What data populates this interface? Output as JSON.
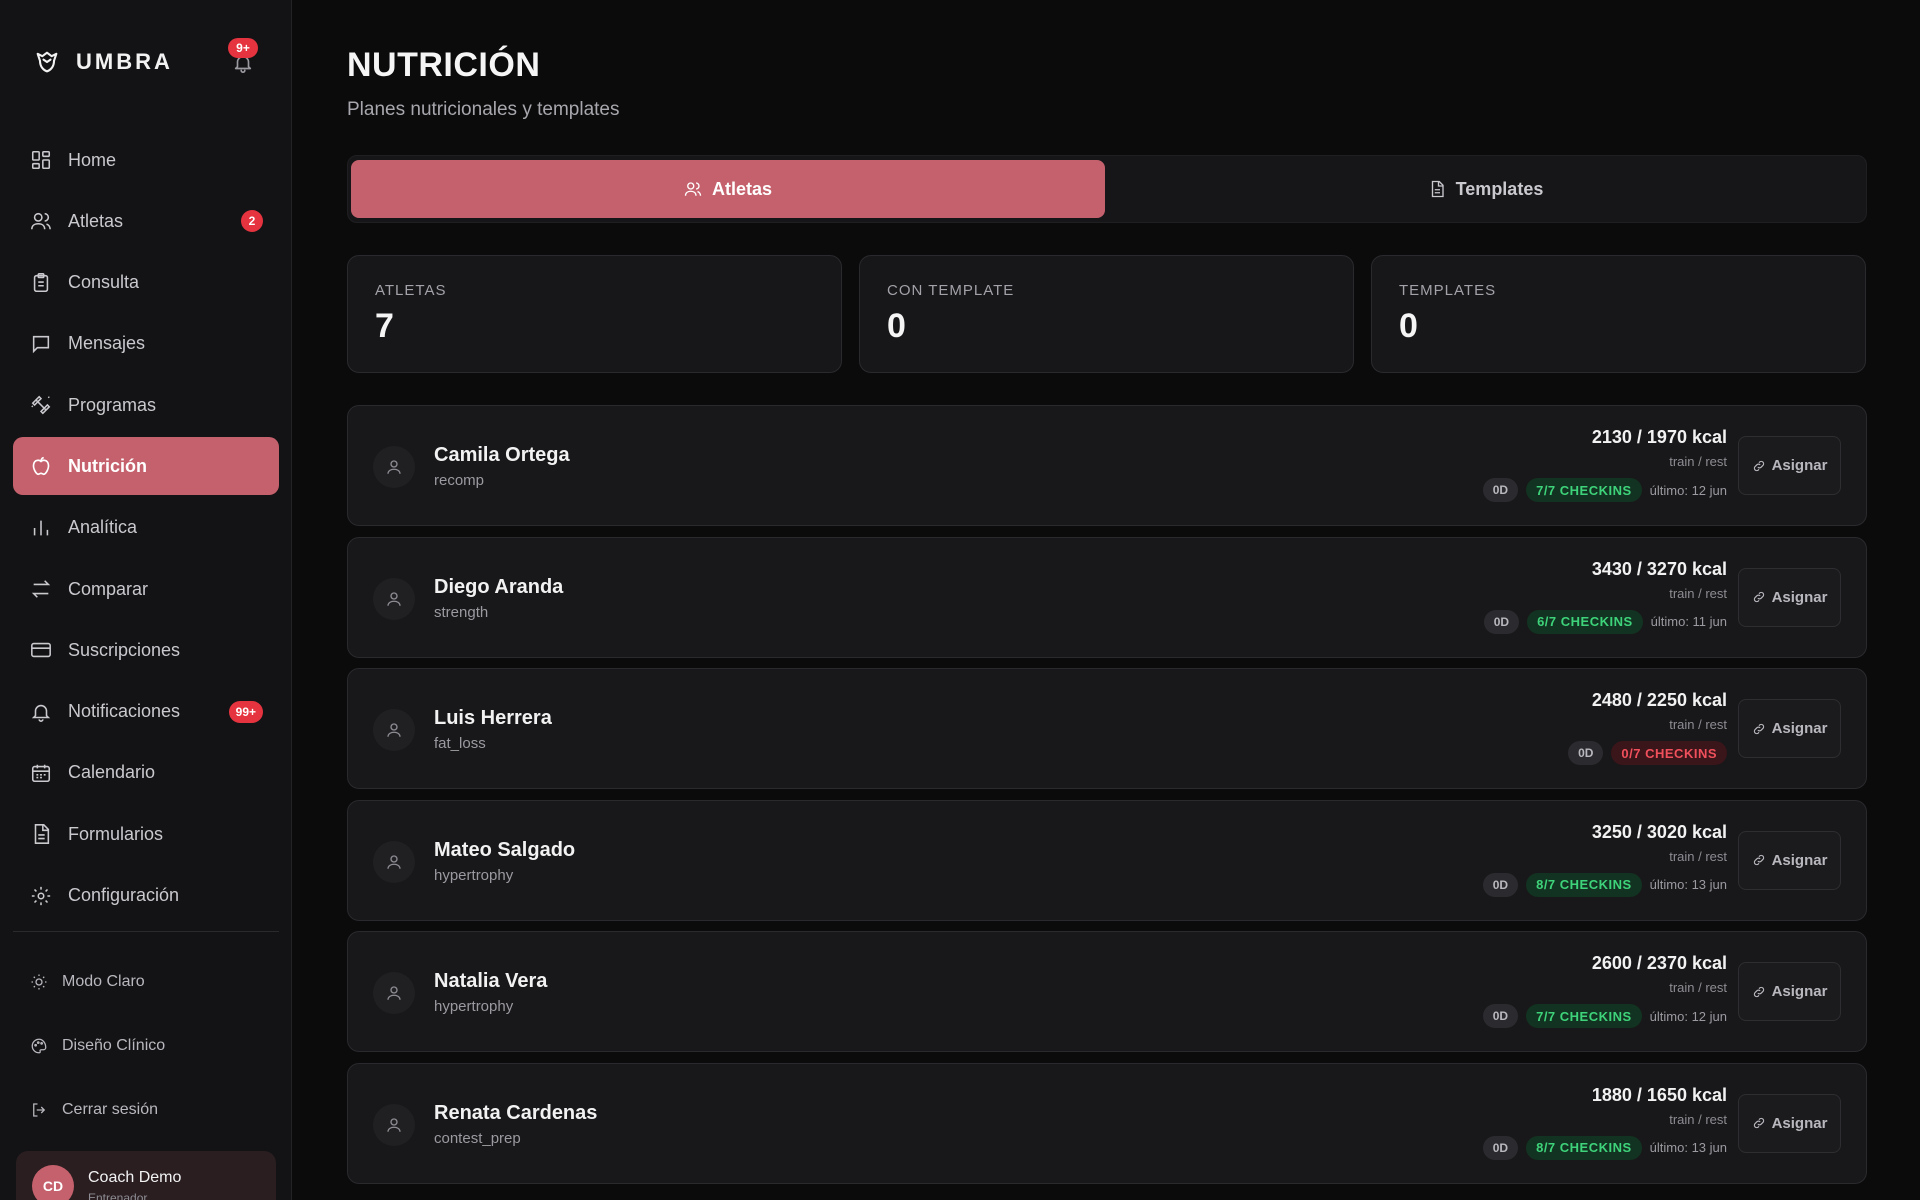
{
  "brand": {
    "name": "UMBRA"
  },
  "notifications": {
    "badge": "9+"
  },
  "nav": [
    {
      "label": "Home",
      "icon": "grid-icon",
      "active": false,
      "badge": ""
    },
    {
      "label": "Atletas",
      "icon": "users-icon",
      "active": false,
      "badge": "2"
    },
    {
      "label": "Consulta",
      "icon": "clipboard-icon",
      "active": false,
      "badge": ""
    },
    {
      "label": "Mensajes",
      "icon": "message-icon",
      "active": false,
      "badge": ""
    },
    {
      "label": "Programas",
      "icon": "dumbbell-icon",
      "active": false,
      "badge": ""
    },
    {
      "label": "Nutrición",
      "icon": "apple-icon",
      "active": true,
      "badge": ""
    },
    {
      "label": "Analítica",
      "icon": "bar-chart-icon",
      "active": false,
      "badge": ""
    },
    {
      "label": "Comparar",
      "icon": "arrows-icon",
      "active": false,
      "badge": ""
    },
    {
      "label": "Suscripciones",
      "icon": "card-icon",
      "active": false,
      "badge": ""
    },
    {
      "label": "Notificaciones",
      "icon": "bell-icon",
      "active": false,
      "badge": "99+"
    },
    {
      "label": "Calendario",
      "icon": "calendar-icon",
      "active": false,
      "badge": ""
    },
    {
      "label": "Formularios",
      "icon": "file-icon",
      "active": false,
      "badge": ""
    },
    {
      "label": "Configuración",
      "icon": "gear-icon",
      "active": false,
      "badge": ""
    }
  ],
  "footer": {
    "light_mode": "Modo Claro",
    "clinical": "Diseño Clínico",
    "logout": "Cerrar sesión"
  },
  "coach": {
    "initials": "CD",
    "name": "Coach Demo",
    "role": "Entrenador"
  },
  "page": {
    "title": "NUTRICIÓN",
    "subtitle": "Planes nutricionales y templates"
  },
  "tabs": {
    "athletes": "Atletas",
    "templates": "Templates"
  },
  "stats": [
    {
      "label": "ATLETAS",
      "value": "7"
    },
    {
      "label": "CON TEMPLATE",
      "value": "0"
    },
    {
      "label": "TEMPLATES",
      "value": "0"
    }
  ],
  "athletes": [
    {
      "name": "Camila Ortega",
      "goal": "recomp",
      "kcal": "2130 / 1970 kcal",
      "train_rest": "train / rest",
      "od": "0D",
      "checkins": "7/7 CHECKINS",
      "checkins_status": "good",
      "last": "último: 12 jun"
    },
    {
      "name": "Diego Aranda",
      "goal": "strength",
      "kcal": "3430 / 3270 kcal",
      "train_rest": "train / rest",
      "od": "0D",
      "checkins": "6/7 CHECKINS",
      "checkins_status": "good",
      "last": "último: 11 jun"
    },
    {
      "name": "Luis Herrera",
      "goal": "fat_loss",
      "kcal": "2480 / 2250 kcal",
      "train_rest": "train / rest",
      "od": "0D",
      "checkins": "0/7 CHECKINS",
      "checkins_status": "bad",
      "last": ""
    },
    {
      "name": "Mateo Salgado",
      "goal": "hypertrophy",
      "kcal": "3250 / 3020 kcal",
      "train_rest": "train / rest",
      "od": "0D",
      "checkins": "8/7 CHECKINS",
      "checkins_status": "good",
      "last": "último: 13 jun"
    },
    {
      "name": "Natalia Vera",
      "goal": "hypertrophy",
      "kcal": "2600 / 2370 kcal",
      "train_rest": "train / rest",
      "od": "0D",
      "checkins": "7/7 CHECKINS",
      "checkins_status": "good",
      "last": "último: 12 jun"
    },
    {
      "name": "Renata Cardenas",
      "goal": "contest_prep",
      "kcal": "1880 / 1650 kcal",
      "train_rest": "train / rest",
      "od": "0D",
      "checkins": "8/7 CHECKINS",
      "checkins_status": "good",
      "last": "último: 13 jun"
    }
  ],
  "assign_label": "Asignar",
  "colors": {
    "accent": "#c5616d",
    "badge": "#e5343f",
    "good": "#3ed37a",
    "bad": "#f0505c"
  }
}
